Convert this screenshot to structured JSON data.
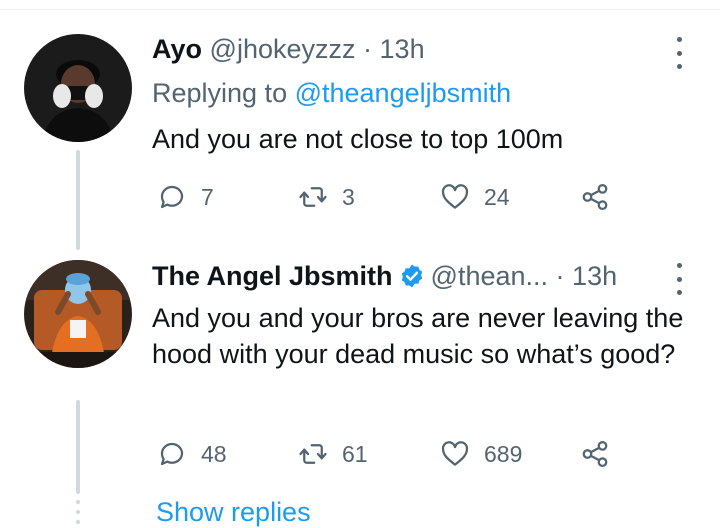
{
  "tweets": [
    {
      "name": "Ayo",
      "handle": "@jhokeyzzz",
      "separator": "·",
      "time": "13h",
      "reply_prefix": "Replying to ",
      "reply_mention": "@theangeljbsmith",
      "text": "And you are not close to top 100m",
      "replies": "7",
      "retweets": "3",
      "likes": "24"
    },
    {
      "name": "The Angel Jbsmith",
      "handle": "@thean...",
      "separator": "·",
      "time": "13h",
      "text": "And you and your bros are never leaving the hood with your dead music so what’s good?",
      "replies": "48",
      "retweets": "61",
      "likes": "689"
    }
  ],
  "show_replies": "Show replies",
  "colors": {
    "accent": "#1d9bf0",
    "secondary_text": "#536471",
    "thread_line": "#cfd9de"
  },
  "icons": [
    "reply-icon",
    "retweet-icon",
    "like-icon",
    "share-icon",
    "more-icon",
    "verified-badge-icon"
  ]
}
